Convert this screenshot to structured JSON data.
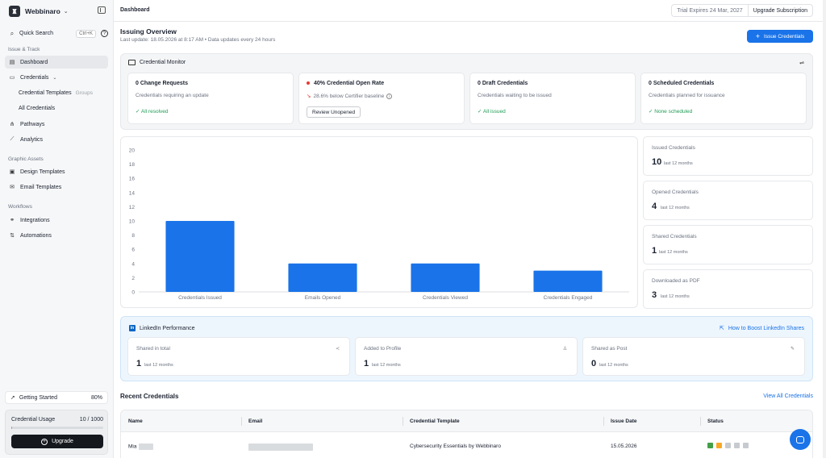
{
  "sidebar": {
    "brand": "Webbinaro",
    "search": {
      "label": "Quick Search",
      "shortcut": "Ctrl+K"
    },
    "sections": {
      "issue_track": "Issue & Track",
      "graphic_assets": "Graphic Assets",
      "workflows": "Workflows"
    },
    "items": {
      "dashboard": "Dashboard",
      "credentials": "Credentials",
      "credential_templates": "Credential Templates",
      "groups": "Groups",
      "all_credentials": "All Credentials",
      "pathways": "Pathways",
      "analytics": "Analytics",
      "design_templates": "Design Templates",
      "email_templates": "Email Templates",
      "integrations": "Integrations",
      "automations": "Automations"
    },
    "getting_started": {
      "label": "Getting Started",
      "percent": "80%"
    },
    "usage": {
      "label": "Credential Usage",
      "value": "10 / 1000",
      "fraction": 0.01,
      "upgrade": "Upgrade"
    }
  },
  "topbar": {
    "breadcrumb": "Dashboard",
    "trial": "Trial Expires 24 Mar, 2027",
    "upgrade": "Upgrade Subscription"
  },
  "header": {
    "title": "Issuing Overview",
    "subtitle": "Last update: 18.05.2026 at 8:17 AM  •  Data updates every 24 hours",
    "issue_button": "Issue Credentials"
  },
  "monitor": {
    "title": "Credential Monitor",
    "cards": [
      {
        "title": "0 Change Requests",
        "sub": "Credentials requiring an update",
        "status": "✓  All resolved"
      },
      {
        "title": "40% Credential Open Rate",
        "sub": "28.6% below Certifier baseline",
        "action": "Review Unopened"
      },
      {
        "title": "0 Draft Credentials",
        "sub": "Credentials waiting to be issued",
        "status": "✓  All issued"
      },
      {
        "title": "0 Scheduled Credentials",
        "sub": "Credentials planned for issuance",
        "status": "✓  None scheduled"
      }
    ]
  },
  "chart_data": {
    "type": "bar",
    "categories": [
      "Credentials Issued",
      "Emails Opened",
      "Credentials Viewed",
      "Credentials Engaged"
    ],
    "values": [
      10,
      4,
      4,
      3
    ],
    "ylim": [
      0,
      20
    ],
    "yticks": [
      0,
      2,
      4,
      6,
      8,
      10,
      12,
      14,
      16,
      18,
      20
    ],
    "title": "",
    "xlabel": "",
    "ylabel": "",
    "grid": false,
    "bar_color": "#1a73e8"
  },
  "stats": [
    {
      "label": "Issued Credentials",
      "value": "10",
      "period": "last 12 months"
    },
    {
      "label": "Opened Credentials",
      "value": "4",
      "period": "last 12 months"
    },
    {
      "label": "Shared Credentials",
      "value": "1",
      "period": "last 12 months"
    },
    {
      "label": "Downloaded as PDF",
      "value": "3",
      "period": "last 12 months"
    }
  ],
  "linkedin": {
    "title": "LinkedIn Performance",
    "link": "How to Boost LinkedIn Shares",
    "cards": [
      {
        "label": "Shared in total",
        "value": "1",
        "period": "last 12 months"
      },
      {
        "label": "Added to Profile",
        "value": "1",
        "period": "last 12 months"
      },
      {
        "label": "Shared as Post",
        "value": "0",
        "period": "last 12 months"
      }
    ]
  },
  "recent": {
    "title": "Recent Credentials",
    "view_all": "View All Credentials",
    "columns": [
      "Name",
      "Email",
      "Credential Template",
      "Issue Date",
      "Status"
    ],
    "rows": [
      {
        "name": "Mia",
        "template": "Cybersecurity Essentials by Webbinaro",
        "date": "15.05.2026"
      }
    ]
  },
  "colors": {
    "accent": "#1a73e8",
    "success": "#1f9d55",
    "danger": "#e53935"
  }
}
